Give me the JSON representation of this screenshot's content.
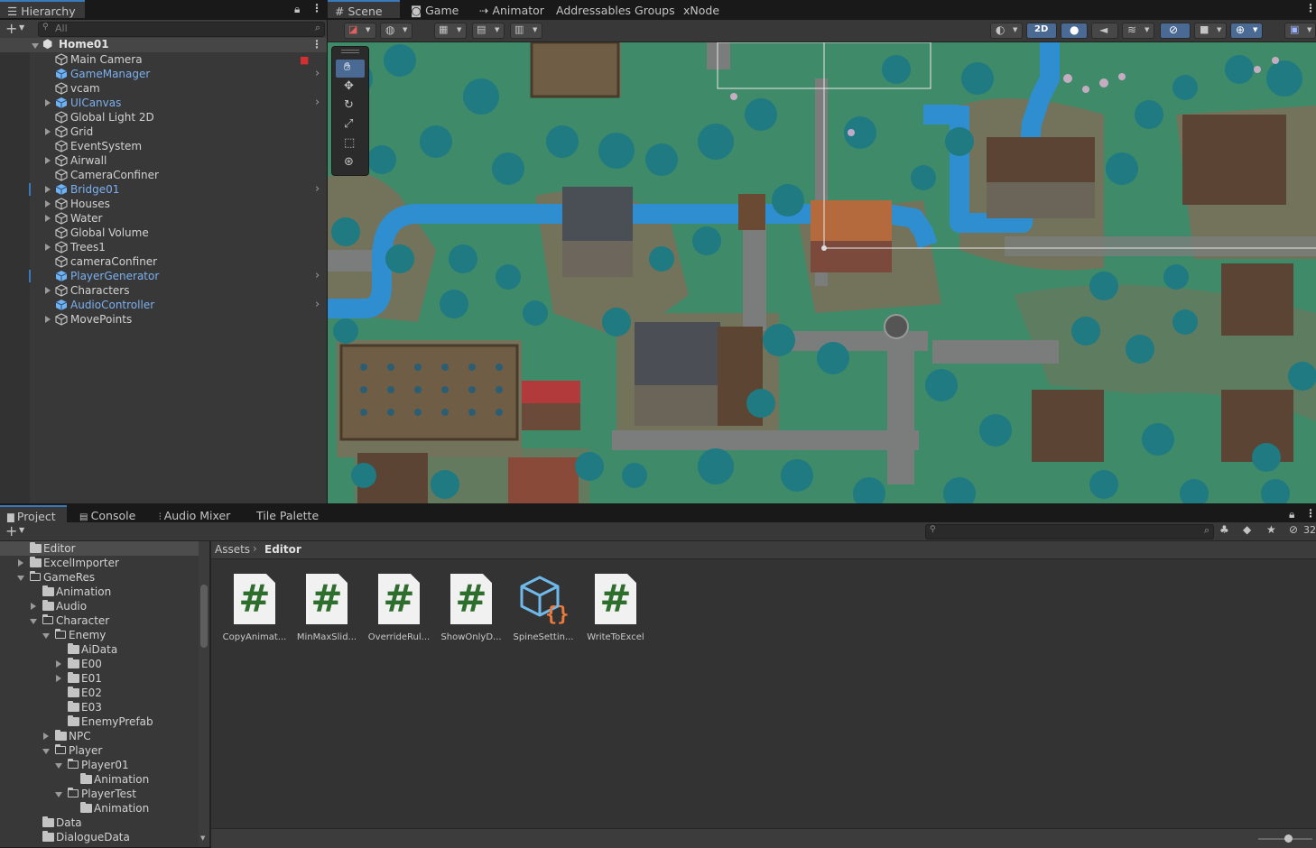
{
  "hierarchy": {
    "tab_label": "Hierarchy",
    "search_placeholder": "All",
    "scene_name": "Home01",
    "items": [
      {
        "label": "Main Camera",
        "prefab": false,
        "expandable": false
      },
      {
        "label": "GameManager",
        "prefab": true,
        "expandable": false
      },
      {
        "label": "vcam",
        "prefab": false,
        "expandable": false
      },
      {
        "label": "UICanvas",
        "prefab": true,
        "expandable": true
      },
      {
        "label": "Global Light 2D",
        "prefab": false,
        "expandable": false
      },
      {
        "label": "Grid",
        "prefab": false,
        "expandable": true
      },
      {
        "label": "EventSystem",
        "prefab": false,
        "expandable": false
      },
      {
        "label": "Airwall",
        "prefab": false,
        "expandable": true
      },
      {
        "label": "CameraConfiner",
        "prefab": false,
        "expandable": false
      },
      {
        "label": "Bridge01",
        "prefab": true,
        "expandable": true
      },
      {
        "label": "Houses",
        "prefab": false,
        "expandable": true
      },
      {
        "label": "Water",
        "prefab": false,
        "expandable": true
      },
      {
        "label": "Global Volume",
        "prefab": false,
        "expandable": false
      },
      {
        "label": "Trees1",
        "prefab": false,
        "expandable": true
      },
      {
        "label": "cameraConfiner",
        "prefab": false,
        "expandable": false
      },
      {
        "label": "PlayerGenerator",
        "prefab": true,
        "expandable": false
      },
      {
        "label": "Characters",
        "prefab": false,
        "expandable": true
      },
      {
        "label": "AudioController",
        "prefab": true,
        "expandable": false
      },
      {
        "label": "MovePoints",
        "prefab": false,
        "expandable": true
      }
    ]
  },
  "scene_tabs": [
    {
      "label": "Scene",
      "icon": "grid-icon",
      "active": true
    },
    {
      "label": "Game",
      "icon": "gamepad-icon",
      "active": false
    },
    {
      "label": "Animator",
      "icon": "animator-icon",
      "active": false
    },
    {
      "label": "Addressables Groups",
      "icon": "",
      "active": false
    },
    {
      "label": "xNode",
      "icon": "",
      "active": false
    }
  ],
  "scene_toolbar": {
    "mode_2d_label": "2D"
  },
  "bottom_tabs": [
    {
      "label": "Project",
      "icon": "folder-icon",
      "active": true
    },
    {
      "label": "Console",
      "icon": "console-icon",
      "active": false
    },
    {
      "label": "Audio Mixer",
      "icon": "mixer-icon",
      "active": false
    },
    {
      "label": "Tile Palette",
      "icon": "",
      "active": false
    }
  ],
  "project": {
    "hidden_count": "32",
    "breadcrumb": {
      "root": "Assets",
      "current": "Editor"
    },
    "tree": [
      {
        "label": "Editor",
        "depth": 0,
        "arrow": "none",
        "open": false,
        "selected": true
      },
      {
        "label": "ExcelImporter",
        "depth": 0,
        "arrow": "right",
        "open": false
      },
      {
        "label": "GameRes",
        "depth": 0,
        "arrow": "down",
        "open": true
      },
      {
        "label": "Animation",
        "depth": 1,
        "arrow": "none",
        "open": false
      },
      {
        "label": "Audio",
        "depth": 1,
        "arrow": "right",
        "open": false
      },
      {
        "label": "Character",
        "depth": 1,
        "arrow": "down",
        "open": true
      },
      {
        "label": "Enemy",
        "depth": 2,
        "arrow": "down",
        "open": true
      },
      {
        "label": "AiData",
        "depth": 3,
        "arrow": "none",
        "open": false
      },
      {
        "label": "E00",
        "depth": 3,
        "arrow": "right",
        "open": false
      },
      {
        "label": "E01",
        "depth": 3,
        "arrow": "right",
        "open": false
      },
      {
        "label": "E02",
        "depth": 3,
        "arrow": "none",
        "open": false
      },
      {
        "label": "E03",
        "depth": 3,
        "arrow": "none",
        "open": false
      },
      {
        "label": "EnemyPrefab",
        "depth": 3,
        "arrow": "none",
        "open": false
      },
      {
        "label": "NPC",
        "depth": 2,
        "arrow": "right",
        "open": false
      },
      {
        "label": "Player",
        "depth": 2,
        "arrow": "down",
        "open": true
      },
      {
        "label": "Player01",
        "depth": 3,
        "arrow": "down",
        "open": true
      },
      {
        "label": "Animation",
        "depth": 4,
        "arrow": "none",
        "open": false
      },
      {
        "label": "PlayerTest",
        "depth": 3,
        "arrow": "down",
        "open": true
      },
      {
        "label": "Animation",
        "depth": 4,
        "arrow": "none",
        "open": false
      },
      {
        "label": "Data",
        "depth": 1,
        "arrow": "none",
        "open": false
      },
      {
        "label": "DialogueData",
        "depth": 1,
        "arrow": "none",
        "open": false
      }
    ],
    "assets": [
      {
        "label": "CopyAnimat...",
        "type": "script"
      },
      {
        "label": "MinMaxSlid...",
        "type": "script"
      },
      {
        "label": "OverrideRul...",
        "type": "script"
      },
      {
        "label": "ShowOnlyD...",
        "type": "script"
      },
      {
        "label": "SpineSettin...",
        "type": "json"
      },
      {
        "label": "WriteToExcel",
        "type": "script"
      }
    ]
  },
  "colors": {
    "accent": "#3a79bb",
    "prefab_text": "#7bb0f0",
    "grass": "#3f8f6b",
    "path": "#8a7f67",
    "water": "#2f8ecf",
    "tree": "#1e6f7a"
  }
}
